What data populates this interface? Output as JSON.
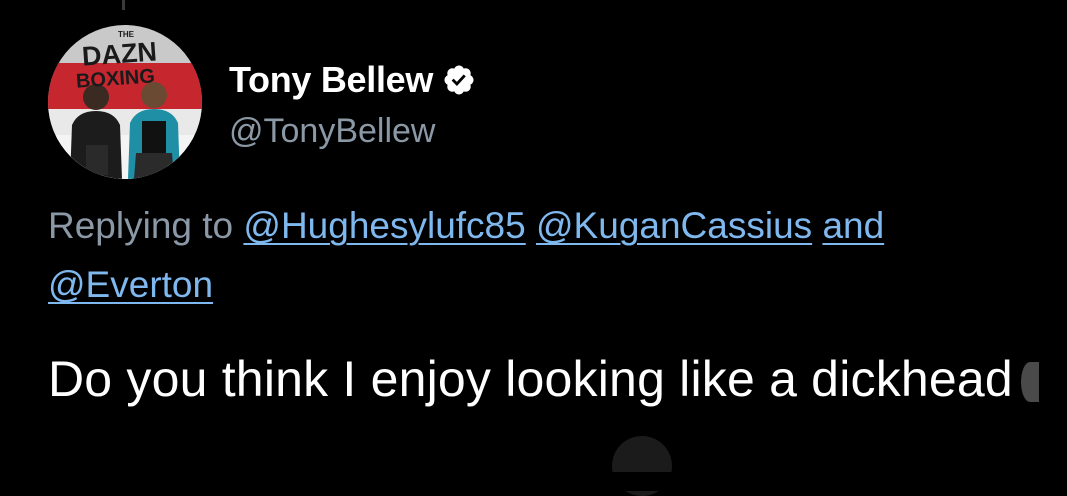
{
  "tweet": {
    "avatar": {
      "icon": "profile-photo",
      "brand_top": "THE",
      "brand": "DAZN",
      "brand_sub": "BOXING"
    },
    "display_name": "Tony Bellew",
    "verified_icon": "verified-badge-icon",
    "handle": "@TonyBellew",
    "replying_prefix": "Replying to",
    "reply_mentions": [
      "@Hughesylufc85",
      "@KuganCassius"
    ],
    "reply_conjunction": "and",
    "reply_last_mention": "@Everton",
    "body_text": "Do you think I enjoy looking like a dickhead"
  },
  "colors": {
    "background": "#000000",
    "name": "#ffffff",
    "secondary_text": "#8b98a5",
    "link": "#7fb8ee",
    "body_text": "#ffffff"
  }
}
